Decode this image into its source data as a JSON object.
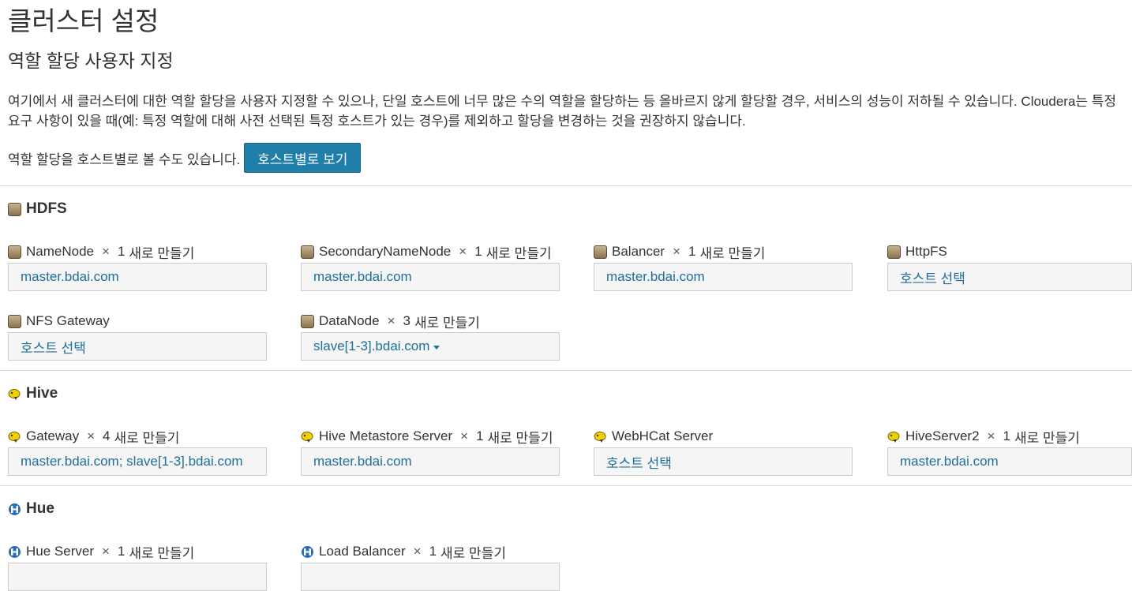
{
  "header": {
    "title": "클러스터 설정",
    "subtitle": "역할 할당 사용자 지정",
    "description": "여기에서 새 클러스터에 대한 역할 할당을 사용자 지정할 수 있으나, 단일 호스트에 너무 많은 수의 역할을 할당하는 등 올바르지 않게 할당할 경우, 서비스의 성능이 저하될 수 있습니다. Cloudera는 특정 요구 사항이 있을 때(예: 특정 역할에 대해 사전 선택된 특정 호스트가 있는 경우)를 제외하고 할당을 변경하는 것을 권장하지 않습니다.",
    "host_view_text": "역할 할당을 호스트별로 볼 수도 있습니다.",
    "host_view_button": "호스트별로 보기"
  },
  "services": {
    "hdfs": {
      "name": "HDFS",
      "icon": "hdfs-icon",
      "roles": [
        {
          "label": "NameNode",
          "times": "×",
          "count": "1",
          "create": "새로 만들기",
          "host": "master.bdai.com"
        },
        {
          "label": "SecondaryNameNode",
          "times": "×",
          "count": "1",
          "create": "새로 만들기",
          "host": "master.bdai.com"
        },
        {
          "label": "Balancer",
          "times": "×",
          "count": "1",
          "create": "새로 만들기",
          "host": "master.bdai.com"
        },
        {
          "label": "HttpFS",
          "host": "호스트 선택"
        },
        {
          "label": "NFS Gateway",
          "host": "호스트 선택"
        },
        {
          "label": "DataNode",
          "times": "×",
          "count": "3",
          "create": "새로 만들기",
          "host": "slave[1-3].bdai.com"
        }
      ]
    },
    "hive": {
      "name": "Hive",
      "icon": "hive-icon",
      "roles": [
        {
          "label": "Gateway",
          "times": "×",
          "count": "4",
          "create": "새로 만들기",
          "host": "master.bdai.com; slave[1-3].bdai.com"
        },
        {
          "label": "Hive Metastore Server",
          "times": "×",
          "count": "1",
          "create": "새로 만들기",
          "host": "master.bdai.com"
        },
        {
          "label": "WebHCat Server",
          "host": "호스트 선택"
        },
        {
          "label": "HiveServer2",
          "times": "×",
          "count": "1",
          "create": "새로 만들기",
          "host": "master.bdai.com"
        }
      ]
    },
    "hue": {
      "name": "Hue",
      "icon": "hue-icon",
      "roles": [
        {
          "label": "Hue Server",
          "times": "×",
          "count": "1",
          "create": "새로 만들기"
        },
        {
          "label": "Load Balancer",
          "times": "×",
          "count": "1",
          "create": "새로 만들기"
        }
      ]
    }
  },
  "colors": {
    "accent_button": "#1f7fa8",
    "link": "#1f6f99"
  }
}
